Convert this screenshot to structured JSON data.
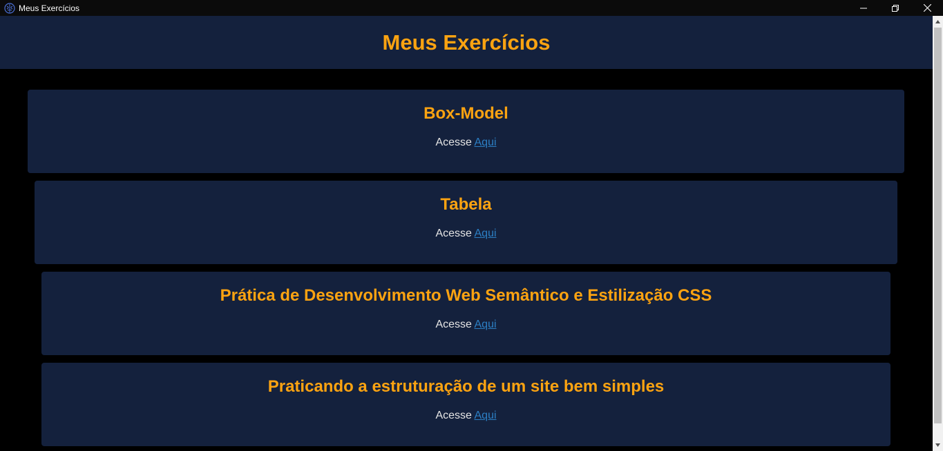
{
  "window": {
    "title": "Meus Exercícios",
    "icon": "brain-icon",
    "controls": [
      "minimize-icon",
      "restore-icon",
      "close-icon"
    ]
  },
  "header": {
    "title": "Meus Exercícios"
  },
  "cards": [
    {
      "title": "Box-Model",
      "prefix": "Acesse ",
      "link": "Aqui"
    },
    {
      "title": "Tabela",
      "prefix": "Acesse ",
      "link": "Aqui"
    },
    {
      "title": "Prática de Desenvolvimento Web Semântico e Estilização CSS",
      "prefix": "Acesse ",
      "link": "Aqui"
    },
    {
      "title": "Praticando a estruturação de um site bem simples",
      "prefix": "Acesse ",
      "link": "Aqui"
    }
  ],
  "colors": {
    "background": "#000000",
    "panel": "#14213d",
    "accent": "#fca311",
    "text": "#e5e5e5",
    "link": "#2c7fc4"
  }
}
